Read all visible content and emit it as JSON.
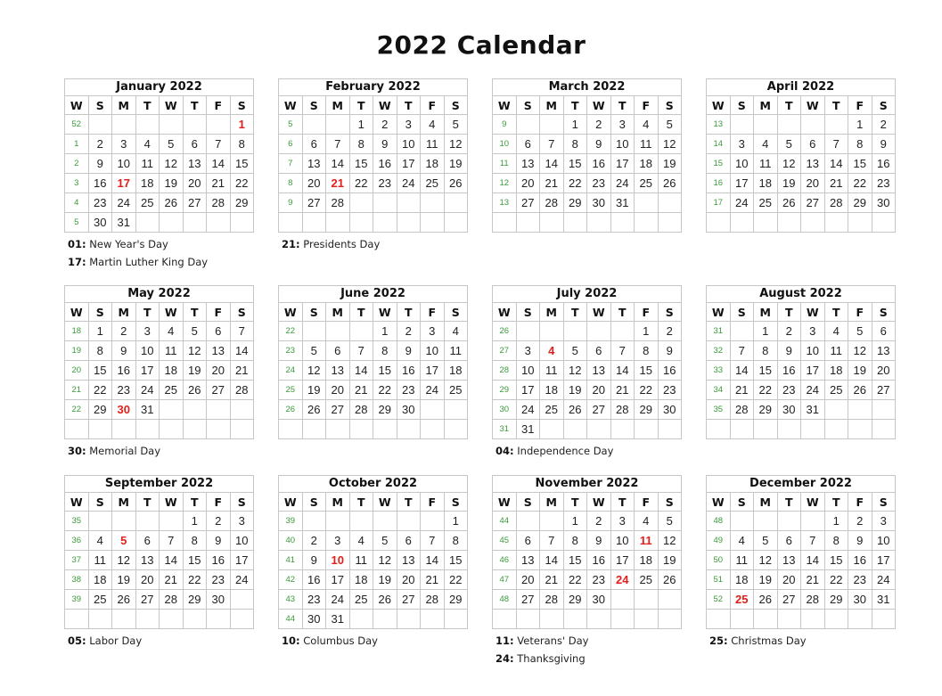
{
  "title": "2022 Calendar",
  "day_headers": [
    "W",
    "S",
    "M",
    "T",
    "W",
    "T",
    "F",
    "S"
  ],
  "colors": {
    "holiday": "#e0201c",
    "week_number": "#3a9a3a",
    "grid": "#c6c6c6"
  },
  "months": [
    {
      "name": "January 2022",
      "weeks": [
        {
          "wk": "52",
          "days": [
            "",
            "",
            "",
            "",
            "",
            "",
            "1"
          ]
        },
        {
          "wk": "1",
          "days": [
            "2",
            "3",
            "4",
            "5",
            "6",
            "7",
            "8"
          ]
        },
        {
          "wk": "2",
          "days": [
            "9",
            "10",
            "11",
            "12",
            "13",
            "14",
            "15"
          ]
        },
        {
          "wk": "3",
          "days": [
            "16",
            "17",
            "18",
            "19",
            "20",
            "21",
            "22"
          ]
        },
        {
          "wk": "4",
          "days": [
            "23",
            "24",
            "25",
            "26",
            "27",
            "28",
            "29"
          ]
        },
        {
          "wk": "5",
          "days": [
            "30",
            "31",
            "",
            "",
            "",
            "",
            ""
          ]
        }
      ],
      "holidays_marked": [
        "1",
        "17"
      ],
      "holidays": [
        {
          "day": "01:",
          "name": "New Year's Day"
        },
        {
          "day": "17:",
          "name": "Martin Luther King Day"
        }
      ]
    },
    {
      "name": "February 2022",
      "weeks": [
        {
          "wk": "5",
          "days": [
            "",
            "",
            "1",
            "2",
            "3",
            "4",
            "5"
          ]
        },
        {
          "wk": "6",
          "days": [
            "6",
            "7",
            "8",
            "9",
            "10",
            "11",
            "12"
          ]
        },
        {
          "wk": "7",
          "days": [
            "13",
            "14",
            "15",
            "16",
            "17",
            "18",
            "19"
          ]
        },
        {
          "wk": "8",
          "days": [
            "20",
            "21",
            "22",
            "23",
            "24",
            "25",
            "26"
          ]
        },
        {
          "wk": "9",
          "days": [
            "27",
            "28",
            "",
            "",
            "",
            "",
            ""
          ]
        },
        {
          "wk": "",
          "days": [
            "",
            "",
            "",
            "",
            "",
            "",
            ""
          ]
        }
      ],
      "holidays_marked": [
        "21"
      ],
      "holidays": [
        {
          "day": "21:",
          "name": "Presidents Day"
        }
      ]
    },
    {
      "name": "March 2022",
      "weeks": [
        {
          "wk": "9",
          "days": [
            "",
            "",
            "1",
            "2",
            "3",
            "4",
            "5"
          ]
        },
        {
          "wk": "10",
          "days": [
            "6",
            "7",
            "8",
            "9",
            "10",
            "11",
            "12"
          ]
        },
        {
          "wk": "11",
          "days": [
            "13",
            "14",
            "15",
            "16",
            "17",
            "18",
            "19"
          ]
        },
        {
          "wk": "12",
          "days": [
            "20",
            "21",
            "22",
            "23",
            "24",
            "25",
            "26"
          ]
        },
        {
          "wk": "13",
          "days": [
            "27",
            "28",
            "29",
            "30",
            "31",
            "",
            ""
          ]
        },
        {
          "wk": "",
          "days": [
            "",
            "",
            "",
            "",
            "",
            "",
            ""
          ]
        }
      ],
      "holidays_marked": [],
      "holidays": []
    },
    {
      "name": "April 2022",
      "weeks": [
        {
          "wk": "13",
          "days": [
            "",
            "",
            "",
            "",
            "",
            "1",
            "2"
          ]
        },
        {
          "wk": "14",
          "days": [
            "3",
            "4",
            "5",
            "6",
            "7",
            "8",
            "9"
          ]
        },
        {
          "wk": "15",
          "days": [
            "10",
            "11",
            "12",
            "13",
            "14",
            "15",
            "16"
          ]
        },
        {
          "wk": "16",
          "days": [
            "17",
            "18",
            "19",
            "20",
            "21",
            "22",
            "23"
          ]
        },
        {
          "wk": "17",
          "days": [
            "24",
            "25",
            "26",
            "27",
            "28",
            "29",
            "30"
          ]
        },
        {
          "wk": "",
          "days": [
            "",
            "",
            "",
            "",
            "",
            "",
            ""
          ]
        }
      ],
      "holidays_marked": [],
      "holidays": []
    },
    {
      "name": "May 2022",
      "weeks": [
        {
          "wk": "18",
          "days": [
            "1",
            "2",
            "3",
            "4",
            "5",
            "6",
            "7"
          ]
        },
        {
          "wk": "19",
          "days": [
            "8",
            "9",
            "10",
            "11",
            "12",
            "13",
            "14"
          ]
        },
        {
          "wk": "20",
          "days": [
            "15",
            "16",
            "17",
            "18",
            "19",
            "20",
            "21"
          ]
        },
        {
          "wk": "21",
          "days": [
            "22",
            "23",
            "24",
            "25",
            "26",
            "27",
            "28"
          ]
        },
        {
          "wk": "22",
          "days": [
            "29",
            "30",
            "31",
            "",
            "",
            "",
            ""
          ]
        },
        {
          "wk": "",
          "days": [
            "",
            "",
            "",
            "",
            "",
            "",
            ""
          ]
        }
      ],
      "holidays_marked": [
        "30"
      ],
      "holidays": [
        {
          "day": "30:",
          "name": "Memorial Day"
        }
      ]
    },
    {
      "name": "June 2022",
      "weeks": [
        {
          "wk": "22",
          "days": [
            "",
            "",
            "",
            "1",
            "2",
            "3",
            "4"
          ]
        },
        {
          "wk": "23",
          "days": [
            "5",
            "6",
            "7",
            "8",
            "9",
            "10",
            "11"
          ]
        },
        {
          "wk": "24",
          "days": [
            "12",
            "13",
            "14",
            "15",
            "16",
            "17",
            "18"
          ]
        },
        {
          "wk": "25",
          "days": [
            "19",
            "20",
            "21",
            "22",
            "23",
            "24",
            "25"
          ]
        },
        {
          "wk": "26",
          "days": [
            "26",
            "27",
            "28",
            "29",
            "30",
            "",
            ""
          ]
        },
        {
          "wk": "",
          "days": [
            "",
            "",
            "",
            "",
            "",
            "",
            ""
          ]
        }
      ],
      "holidays_marked": [],
      "holidays": []
    },
    {
      "name": "July 2022",
      "weeks": [
        {
          "wk": "26",
          "days": [
            "",
            "",
            "",
            "",
            "",
            "1",
            "2"
          ]
        },
        {
          "wk": "27",
          "days": [
            "3",
            "4",
            "5",
            "6",
            "7",
            "8",
            "9"
          ]
        },
        {
          "wk": "28",
          "days": [
            "10",
            "11",
            "12",
            "13",
            "14",
            "15",
            "16"
          ]
        },
        {
          "wk": "29",
          "days": [
            "17",
            "18",
            "19",
            "20",
            "21",
            "22",
            "23"
          ]
        },
        {
          "wk": "30",
          "days": [
            "24",
            "25",
            "26",
            "27",
            "28",
            "29",
            "30"
          ]
        },
        {
          "wk": "31",
          "days": [
            "31",
            "",
            "",
            "",
            "",
            "",
            ""
          ]
        }
      ],
      "holidays_marked": [
        "4"
      ],
      "holidays": [
        {
          "day": "04:",
          "name": "Independence Day"
        }
      ]
    },
    {
      "name": "August 2022",
      "weeks": [
        {
          "wk": "31",
          "days": [
            "",
            "1",
            "2",
            "3",
            "4",
            "5",
            "6"
          ]
        },
        {
          "wk": "32",
          "days": [
            "7",
            "8",
            "9",
            "10",
            "11",
            "12",
            "13"
          ]
        },
        {
          "wk": "33",
          "days": [
            "14",
            "15",
            "16",
            "17",
            "18",
            "19",
            "20"
          ]
        },
        {
          "wk": "34",
          "days": [
            "21",
            "22",
            "23",
            "24",
            "25",
            "26",
            "27"
          ]
        },
        {
          "wk": "35",
          "days": [
            "28",
            "29",
            "30",
            "31",
            "",
            "",
            ""
          ]
        },
        {
          "wk": "",
          "days": [
            "",
            "",
            "",
            "",
            "",
            "",
            ""
          ]
        }
      ],
      "holidays_marked": [],
      "holidays": []
    },
    {
      "name": "September 2022",
      "weeks": [
        {
          "wk": "35",
          "days": [
            "",
            "",
            "",
            "",
            "1",
            "2",
            "3"
          ]
        },
        {
          "wk": "36",
          "days": [
            "4",
            "5",
            "6",
            "7",
            "8",
            "9",
            "10"
          ]
        },
        {
          "wk": "37",
          "days": [
            "11",
            "12",
            "13",
            "14",
            "15",
            "16",
            "17"
          ]
        },
        {
          "wk": "38",
          "days": [
            "18",
            "19",
            "20",
            "21",
            "22",
            "23",
            "24"
          ]
        },
        {
          "wk": "39",
          "days": [
            "25",
            "26",
            "27",
            "28",
            "29",
            "30",
            ""
          ]
        },
        {
          "wk": "",
          "days": [
            "",
            "",
            "",
            "",
            "",
            "",
            ""
          ]
        }
      ],
      "holidays_marked": [
        "5"
      ],
      "holidays": [
        {
          "day": "05:",
          "name": "Labor Day"
        }
      ]
    },
    {
      "name": "October 2022",
      "weeks": [
        {
          "wk": "39",
          "days": [
            "",
            "",
            "",
            "",
            "",
            "",
            "1"
          ]
        },
        {
          "wk": "40",
          "days": [
            "2",
            "3",
            "4",
            "5",
            "6",
            "7",
            "8"
          ]
        },
        {
          "wk": "41",
          "days": [
            "9",
            "10",
            "11",
            "12",
            "13",
            "14",
            "15"
          ]
        },
        {
          "wk": "42",
          "days": [
            "16",
            "17",
            "18",
            "19",
            "20",
            "21",
            "22"
          ]
        },
        {
          "wk": "43",
          "days": [
            "23",
            "24",
            "25",
            "26",
            "27",
            "28",
            "29"
          ]
        },
        {
          "wk": "44",
          "days": [
            "30",
            "31",
            "",
            "",
            "",
            "",
            ""
          ]
        }
      ],
      "holidays_marked": [
        "10"
      ],
      "holidays": [
        {
          "day": "10:",
          "name": "Columbus Day"
        }
      ]
    },
    {
      "name": "November 2022",
      "weeks": [
        {
          "wk": "44",
          "days": [
            "",
            "",
            "1",
            "2",
            "3",
            "4",
            "5"
          ]
        },
        {
          "wk": "45",
          "days": [
            "6",
            "7",
            "8",
            "9",
            "10",
            "11",
            "12"
          ]
        },
        {
          "wk": "46",
          "days": [
            "13",
            "14",
            "15",
            "16",
            "17",
            "18",
            "19"
          ]
        },
        {
          "wk": "47",
          "days": [
            "20",
            "21",
            "22",
            "23",
            "24",
            "25",
            "26"
          ]
        },
        {
          "wk": "48",
          "days": [
            "27",
            "28",
            "29",
            "30",
            "",
            "",
            ""
          ]
        },
        {
          "wk": "",
          "days": [
            "",
            "",
            "",
            "",
            "",
            "",
            ""
          ]
        }
      ],
      "holidays_marked": [
        "11",
        "24"
      ],
      "holidays": [
        {
          "day": "11:",
          "name": "Veterans' Day"
        },
        {
          "day": "24:",
          "name": "Thanksgiving"
        }
      ]
    },
    {
      "name": "December 2022",
      "weeks": [
        {
          "wk": "48",
          "days": [
            "",
            "",
            "",
            "",
            "1",
            "2",
            "3"
          ]
        },
        {
          "wk": "49",
          "days": [
            "4",
            "5",
            "6",
            "7",
            "8",
            "9",
            "10"
          ]
        },
        {
          "wk": "50",
          "days": [
            "11",
            "12",
            "13",
            "14",
            "15",
            "16",
            "17"
          ]
        },
        {
          "wk": "51",
          "days": [
            "18",
            "19",
            "20",
            "21",
            "22",
            "23",
            "24"
          ]
        },
        {
          "wk": "52",
          "days": [
            "25",
            "26",
            "27",
            "28",
            "29",
            "30",
            "31"
          ]
        },
        {
          "wk": "",
          "days": [
            "",
            "",
            "",
            "",
            "",
            "",
            ""
          ]
        }
      ],
      "holidays_marked": [
        "25"
      ],
      "holidays": [
        {
          "day": "25:",
          "name": "Christmas Day"
        }
      ]
    }
  ]
}
